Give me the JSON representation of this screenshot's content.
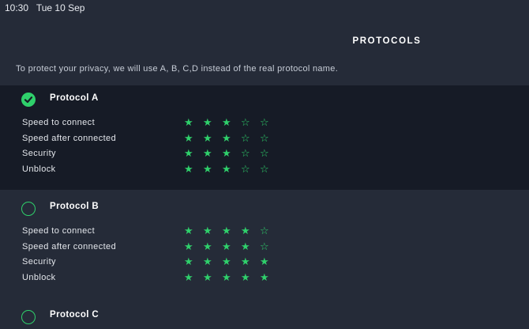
{
  "status_bar": {
    "time": "10:30",
    "date": "Tue 10 Sep"
  },
  "page_title": "PROTOCOLS",
  "subtitle": "To protect your privacy, we will use A, B, C,D instead of the real protocol name.",
  "colors": {
    "accent": "#2fd06b",
    "background": "#252b38",
    "selected_background": "#161b26"
  },
  "max_stars": 5,
  "protocols": [
    {
      "name": "Protocol A",
      "selected": true,
      "metrics": [
        {
          "label": "Speed to connect",
          "rating": 3
        },
        {
          "label": "Speed after connected",
          "rating": 3
        },
        {
          "label": "Security",
          "rating": 3
        },
        {
          "label": "Unblock",
          "rating": 3
        }
      ]
    },
    {
      "name": "Protocol B",
      "selected": false,
      "metrics": [
        {
          "label": "Speed to connect",
          "rating": 4
        },
        {
          "label": "Speed after connected",
          "rating": 4
        },
        {
          "label": "Security",
          "rating": 5
        },
        {
          "label": "Unblock",
          "rating": 5
        }
      ]
    },
    {
      "name": "Protocol C",
      "selected": false,
      "metrics": []
    }
  ]
}
